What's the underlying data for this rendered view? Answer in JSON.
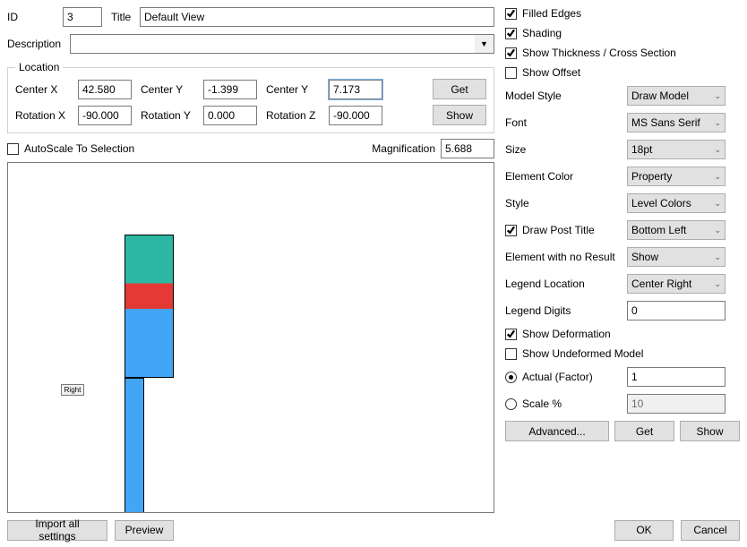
{
  "top": {
    "id_label": "ID",
    "id_value": "3",
    "title_label": "Title",
    "title_value": "Default View",
    "description_label": "Description",
    "description_value": ""
  },
  "location": {
    "legend": "Location",
    "center_x_label": "Center X",
    "center_x": "42.580",
    "center_y1_label": "Center Y",
    "center_y1": "-1.399",
    "center_y2_label": "Center Y",
    "center_y2": "7.173",
    "get": "Get",
    "rotation_x_label": "Rotation X",
    "rotation_x": "-90.000",
    "rotation_y_label": "Rotation Y",
    "rotation_y": "0.000",
    "rotation_z_label": "Rotation Z",
    "rotation_z": "-90.000",
    "show": "Show",
    "autoscale_label": "AutoScale To Selection",
    "magnification_label": "Magnification",
    "magnification": "5.688"
  },
  "compass": {
    "label": "Right"
  },
  "right": {
    "filled_edges": "Filled Edges",
    "shading": "Shading",
    "show_thickness": "Show Thickness / Cross Section",
    "show_offset": "Show Offset",
    "model_style_label": "Model Style",
    "model_style": "Draw Model",
    "font_label": "Font",
    "font": "MS Sans Serif",
    "size_label": "Size",
    "size": "18pt",
    "element_color_label": "Element Color",
    "element_color": "Property",
    "style_label": "Style",
    "style": "Level Colors",
    "draw_post_title": "Draw Post Title",
    "post_title_pos": "Bottom Left",
    "elem_no_result_label": "Element with no Result",
    "elem_no_result": "Show",
    "legend_loc_label": "Legend Location",
    "legend_loc": "Center Right",
    "legend_digits_label": "Legend Digits",
    "legend_digits": "0",
    "show_deformation": "Show Deformation",
    "show_undeformed": "Show Undeformed Model",
    "actual_label": "Actual (Factor)",
    "actual_value": "1",
    "scale_label": "Scale %",
    "scale_value": "10",
    "advanced": "Advanced...",
    "get": "Get",
    "show": "Show"
  },
  "footer": {
    "import_all": "Import all settings",
    "preview": "Preview",
    "ok": "OK",
    "cancel": "Cancel"
  }
}
